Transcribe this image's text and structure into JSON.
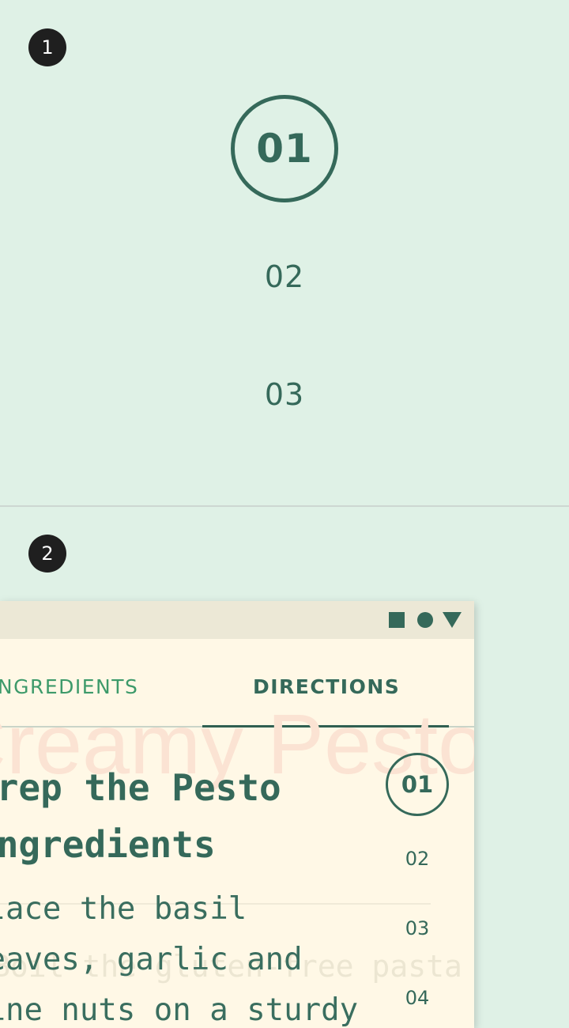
{
  "badges": [
    "1",
    "2"
  ],
  "stepper_large": {
    "steps": [
      "01",
      "02",
      "03"
    ],
    "active_index": 0
  },
  "recipe_window": {
    "controls": [
      "stop-square-icon",
      "home-circle-icon",
      "back-triangle-icon"
    ],
    "tabs": [
      "INGREDIENTS",
      "DIRECTIONS"
    ],
    "active_tab": "DIRECTIONS",
    "background_title": "Creamy Pesto Pasta",
    "background_subtitle": "Boil the gluten-free pasta",
    "step_heading": "Prep the Pesto Ingredients",
    "step_body": "Place the basil leaves, garlic and pine nuts on a sturdy",
    "mini_steps": [
      "01",
      "02",
      "03",
      "04"
    ]
  },
  "colors": {
    "page_bg": "#dff1e6",
    "accent": "#35695a",
    "window_bg": "#fff8e6",
    "titlebar_bg": "#ece8d6"
  }
}
